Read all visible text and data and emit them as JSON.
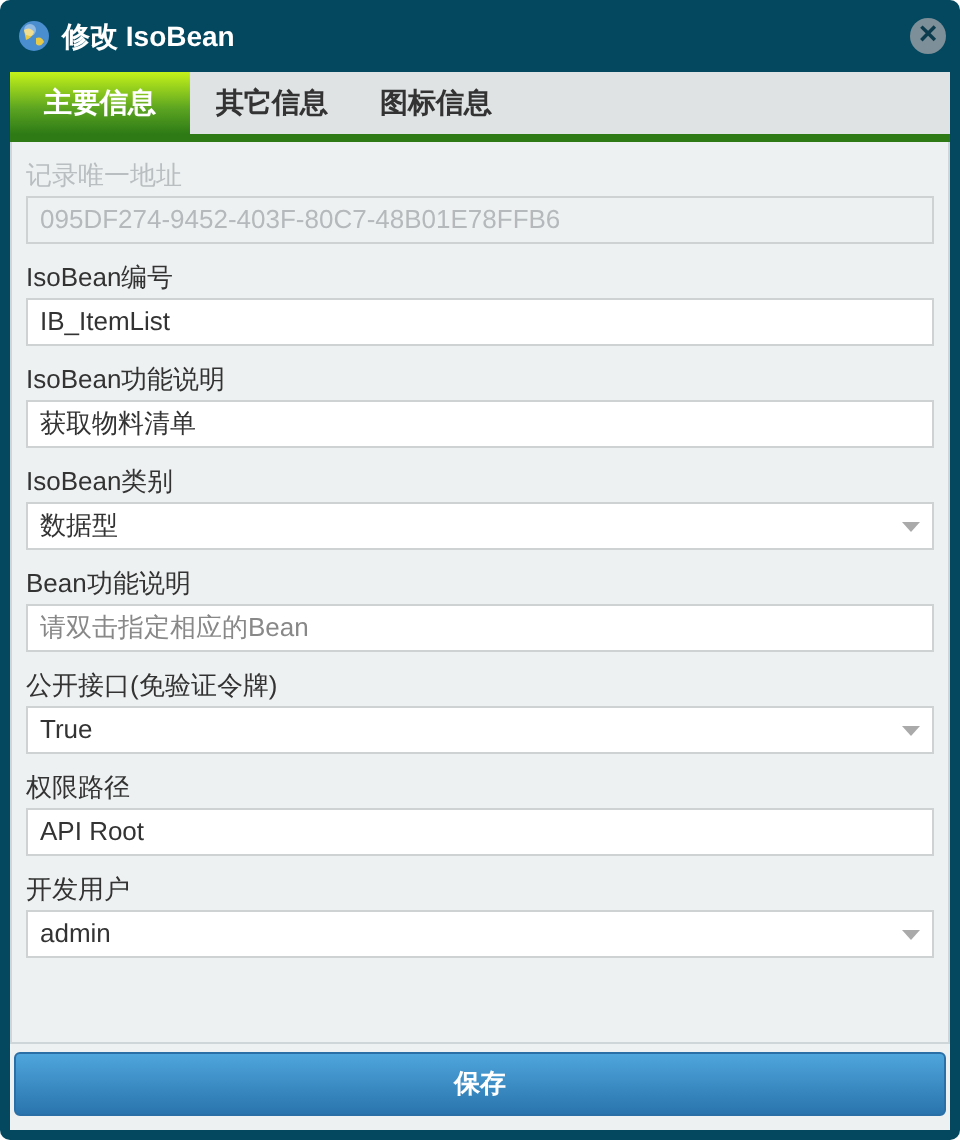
{
  "window": {
    "title": "修改 IsoBean",
    "close": "×"
  },
  "tabs": [
    {
      "label": "主要信息",
      "selected": true
    },
    {
      "label": "其它信息",
      "selected": false
    },
    {
      "label": "图标信息",
      "selected": false
    }
  ],
  "fields": [
    {
      "label": "记录唯一地址",
      "kind": "text",
      "value": "095DF274-9452-403F-80C7-48B01E78FFB6",
      "disabled": true
    },
    {
      "label": "IsoBean编号",
      "kind": "text",
      "value": "IB_ItemList",
      "disabled": false
    },
    {
      "label": "IsoBean功能说明",
      "kind": "text",
      "value": "获取物料清单",
      "disabled": false
    },
    {
      "label": "IsoBean类别",
      "kind": "select",
      "value": "数据型",
      "disabled": false
    },
    {
      "label": "Bean功能说明",
      "kind": "text",
      "placeholder": "请双击指定相应的Bean",
      "disabled": false
    },
    {
      "label": "公开接口(免验证令牌)",
      "kind": "select",
      "value": "True",
      "disabled": false
    },
    {
      "label": "权限路径",
      "kind": "text",
      "value": "API Root",
      "disabled": false
    },
    {
      "label": "开发用户",
      "kind": "select",
      "value": "admin",
      "disabled": false
    }
  ],
  "buttons": [
    {
      "label": "保存"
    }
  ]
}
